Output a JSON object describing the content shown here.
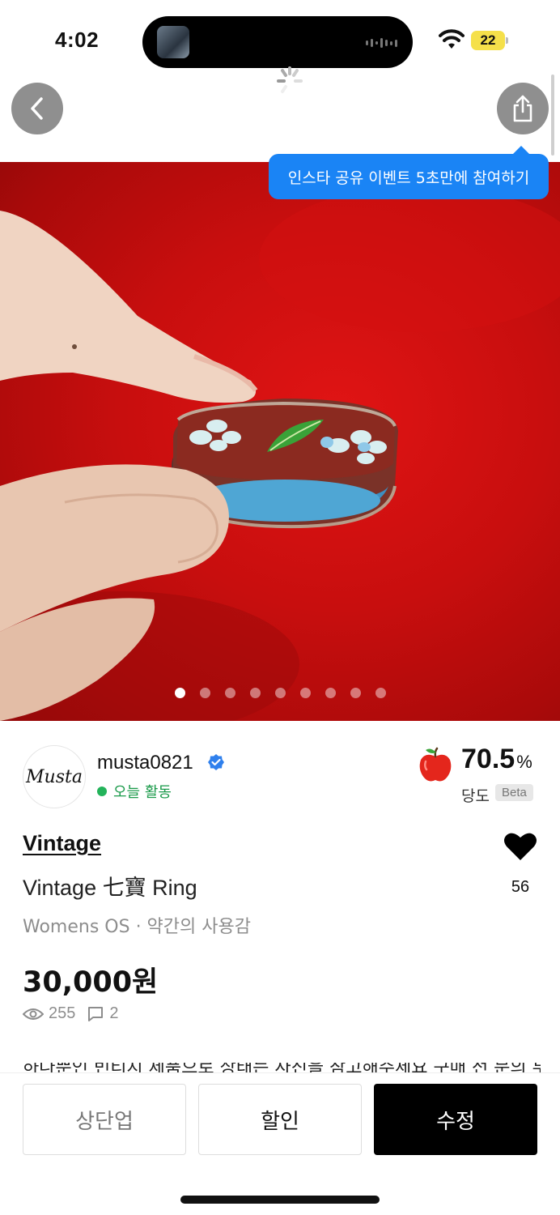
{
  "status_bar": {
    "time": "4:02",
    "battery": "22",
    "icons": [
      "wifi-icon",
      "battery-icon"
    ]
  },
  "nav": {
    "back_icon": "chevron-left-icon",
    "share_icon": "share-icon",
    "loading_icon": "spinner-icon"
  },
  "tooltip": {
    "text": "인스타 공유 이벤트 5초만에 참여하기"
  },
  "gallery": {
    "total_images": 9,
    "active_index": 0
  },
  "seller": {
    "avatar_text": "Musta",
    "name": "musta0821",
    "verified": true,
    "activity": "오늘 활동"
  },
  "sweetness": {
    "value": "70.5",
    "unit": "%",
    "label": "당도",
    "badge": "Beta",
    "icon": "apple-icon"
  },
  "product": {
    "brand": "Vintage",
    "title": "Vintage 七寶 Ring",
    "meta": "Womens OS · 약간의 사용감",
    "price": "30,000원",
    "views": "255",
    "comments": "2",
    "likes": "56",
    "description_preview": "하나뿐인 빈티지 제품으로 상태는 사진을 참고해주세요 구매 전 문의 부탁드립니다"
  },
  "actions": {
    "bump": "상단업",
    "discount": "할인",
    "edit": "수정"
  },
  "colors": {
    "tooltip_bg": "#1a84f5",
    "active_green": "#23b35a",
    "primary_button": "#000000"
  }
}
